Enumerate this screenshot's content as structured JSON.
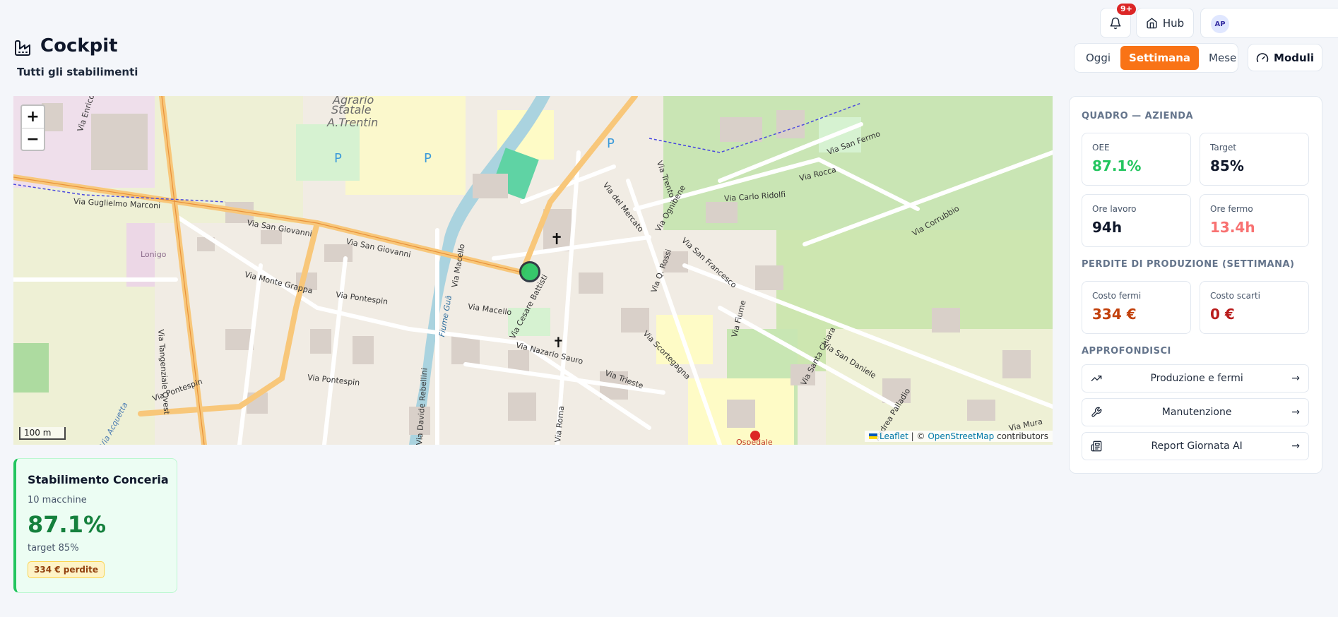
{
  "header": {
    "title": "Cockpit",
    "subtitle": "Tutti gli stabilimenti",
    "notifications_badge": "9+",
    "hub_label": "Hub",
    "user_initials": "AP",
    "moduli_label": "Moduli"
  },
  "period": {
    "options": [
      "Oggi",
      "Settimana",
      "Mese"
    ],
    "selected": "Settimana"
  },
  "map": {
    "zoom_in": "+",
    "zoom_out": "−",
    "scale": "100 m",
    "attribution_leaflet": "Leaflet",
    "attribution_sep": "| ©",
    "attribution_osm": "OpenStreetMap",
    "attribution_suffix": "contributors",
    "labels": {
      "marconi": "Via Guglielmo Marconi",
      "sangiovanni1": "Via San Giovanni",
      "sangiovanni2": "Via San Giovanni",
      "montegrappa": "Via Monte Grappa",
      "pontespin1": "Via Pontespin",
      "pontespin2": "Via Pontespin",
      "pontespin3": "Via Pontespin",
      "tangenziale": "Via Tangenziale Ovest",
      "macello1": "Via Macello",
      "macello2": "Via Macello",
      "fiume": "Fiume Guà",
      "cesare": "Via Cesare Battisti",
      "sauro": "Via Nazario Sauro",
      "trieste": "Via Trieste",
      "roma": "Via Roma",
      "mercato": "Via del Mercato",
      "ognibene": "Via Ognibene",
      "qrossi": "Via Q. Rossi",
      "sanfrancesco": "Via San Francesco",
      "scortegagna": "Via Scortegagna",
      "fiume2": "Via Fiume",
      "santachiara": "Via Santa Chiara",
      "sandaniele": "Via San Daniele",
      "palladio": "Andrea Palladio",
      "carloridolfi": "Via Carlo Ridolfi",
      "rocca": "Via Rocca",
      "sanfermo": "Via San Fermo",
      "corrubbio": "Via Corrubbio",
      "trento": "Via Trento",
      "muraSan": "Via Mura San",
      "enrico": "Via Enrico",
      "acquetta": "Via Acquetta",
      "rebellini": "Via Davide Rebellini",
      "agrario1": "Agrario",
      "agrario2": "Statale",
      "agrario3": "A.Trentin",
      "lonigo": "Lonigo",
      "ospedale": "Ospedale"
    }
  },
  "panel": {
    "quadro_title": "QUADRO — AZIENDA",
    "kpis": [
      {
        "label": "OEE",
        "value": "87.1%",
        "color": "#22c55e"
      },
      {
        "label": "Target",
        "value": "85%",
        "color": "#0f172a"
      },
      {
        "label": "Ore lavoro",
        "value": "94h",
        "color": "#0f172a"
      },
      {
        "label": "Ore fermo",
        "value": "13.4h",
        "color": "#f87171"
      }
    ],
    "perdite_title": "PERDITE DI PRODUZIONE (SETTIMANA)",
    "losses": [
      {
        "label": "Costo fermi",
        "value": "334 €",
        "color": "#c2410c"
      },
      {
        "label": "Costo scarti",
        "value": "0 €",
        "color": "#b91c1c"
      }
    ],
    "approfondisci_title": "APPROFONDISCI",
    "links": [
      {
        "label": "Produzione e fermi",
        "icon": "trend-icon"
      },
      {
        "label": "Manutenzione",
        "icon": "wrench-icon"
      },
      {
        "label": "Report Giornata AI",
        "icon": "report-icon"
      }
    ],
    "arrow": "→"
  },
  "plant": {
    "name": "Stabilimento Conceria",
    "machines": "10 macchine",
    "oee": "87.1%",
    "target": "target 85%",
    "loss": "334 € perdite"
  }
}
